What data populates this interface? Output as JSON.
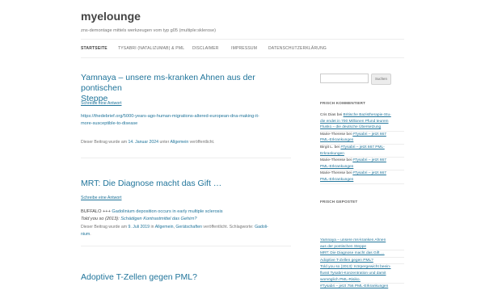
{
  "site": {
    "title": "myelounge",
    "description": "zns-demontage mittels werkzeugen vom typ g05 (multiple:sklerose)"
  },
  "nav": [
    "STARTSEITE",
    "TYSABRI (NATALIZUMAB) & PML",
    "DISCLAIMER",
    "IMPRESSUM",
    "DATENSCHUTZERKLÄRUNG"
  ],
  "posts": [
    {
      "title_l1": "Yamnaya – unsere ms-kranken Ahnen aus der pontischen",
      "title_l2": "Steppe",
      "reply": "Schreibe eine Antwort",
      "link_l1": "https://thedebrief.org/5000-years-ago-human-migrations-altered-european-dna-making-it-",
      "link_l2": "more-susceptible-to-disease",
      "meta_pre": "Dieser Beitrag wurde am ",
      "meta_date": "14. Januar 2024",
      "meta_mid": " unter ",
      "meta_cat": "Allgemein",
      "meta_post": " veröffentlicht."
    },
    {
      "title": "MRT: Die Diagnose macht das Gift …",
      "reply": "Schreibe eine Antwort",
      "line1_pre": "BUFFALO +++ ",
      "line1_link": "Gadolinium deposition occurs in early multiple sclerosis",
      "line2_pre": "Told you so (2013): ",
      "line2_link": "Schädigen Kontrastmittel das Gehirn?",
      "meta_pre": "Dieser Beitrag wurde am ",
      "meta_date": "9. Juli 2019",
      "meta_mid": " in ",
      "meta_cat1": "Allgemein",
      "meta_comma": ", ",
      "meta_cat2": "Gerätschaften",
      "meta_tags": " veröffentlicht. Schlagworte: ",
      "meta_tag": "Gadoli-",
      "meta_tag2": "nium",
      "meta_end": "."
    },
    {
      "title": "Adoptive T-Zellen gegen PML?"
    }
  ],
  "sidebar": {
    "search_button": "Suchen",
    "comments_title": "FRISCH KOMMENTIERT",
    "comments": [
      {
        "pre": "Cris Dias bei ",
        "link": "Britische Bazistherapie-Stu-",
        "post": ""
      },
      {
        "pre": "",
        "link": "die endet in 700 Millionen Pfund teurem",
        "post": ""
      },
      {
        "pre": "",
        "link": "Flusko – die deutsche Übersetzung",
        "post": ""
      },
      {
        "pre": "Marie-Therese bei ",
        "link": "#Tysabri – jetzt 667",
        "post": ""
      },
      {
        "pre": "",
        "link": "PML-Erkrankungen",
        "post": ""
      },
      {
        "pre": "Birgit L. bei ",
        "link": "#Tysabri – jetzt 667 PML-Erkrankungen",
        "post": ""
      },
      {
        "pre": "Marie-Therese bei ",
        "link": "#Tysabri – jetzt 667",
        "post": ""
      },
      {
        "pre": "",
        "link": "PML-Erkrankungen",
        "post": ""
      },
      {
        "pre": "Marie-Therese bei ",
        "link": "#Tysabri – jetzt 667",
        "post": ""
      },
      {
        "pre": "",
        "link": "PML-Erkrankungen",
        "post": ""
      }
    ],
    "recent_title": "FRISCH GEPOSTET",
    "recent": [
      "Yamnaya – unsere ms-kranken Ahnen",
      "aus der pontischen Steppe",
      "MRT: Die Diagnose macht das Gift …",
      "Adoptive T-Zellen gegen PML?",
      "Told you so (2013): Körpergewicht beein-",
      "flusst Tysabri-Konzentration und damit",
      "womöglich PML-Risiko.",
      "#Tysabri – jetzt 756 PML-Erkrankungen"
    ]
  }
}
